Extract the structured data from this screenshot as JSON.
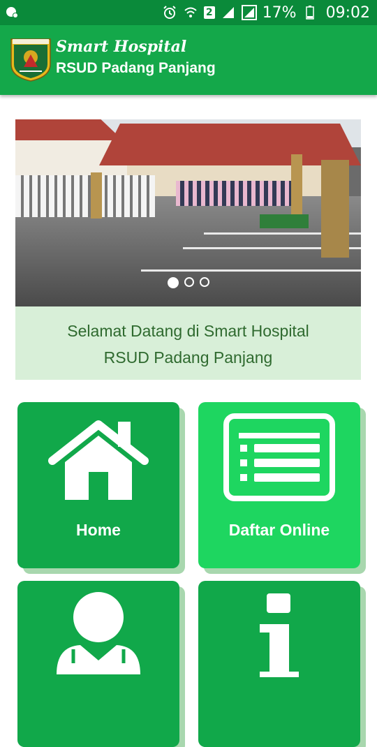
{
  "status_bar": {
    "battery": "17%",
    "time": "09:02",
    "sim_badge": "2",
    "icons": [
      "alarm-icon",
      "wifi-icon",
      "sim-icon",
      "signal-icon",
      "signal-boxed-icon",
      "battery-icon"
    ]
  },
  "app_bar": {
    "script_title": "Smart Hospital",
    "main_title": "RSUD Padang Panjang",
    "logo_banner": "PADANG PANJANG",
    "colors": {
      "bar": "#14a84a",
      "status": "#0a8a3a"
    }
  },
  "carousel": {
    "slide_count": 3,
    "active_index": 0
  },
  "welcome": {
    "line1": "Selamat Datang di Smart Hospital",
    "line2": "RSUD Padang Panjang"
  },
  "menu": [
    {
      "label": "Home",
      "icon": "home-icon",
      "color": "#11a84a"
    },
    {
      "label": "Daftar Online",
      "icon": "registration-list-icon",
      "color": "#1ed660"
    },
    {
      "label": "",
      "icon": "doctor-icon",
      "color": "#11a84a"
    },
    {
      "label": "",
      "icon": "info-icon",
      "color": "#11a84a"
    }
  ]
}
